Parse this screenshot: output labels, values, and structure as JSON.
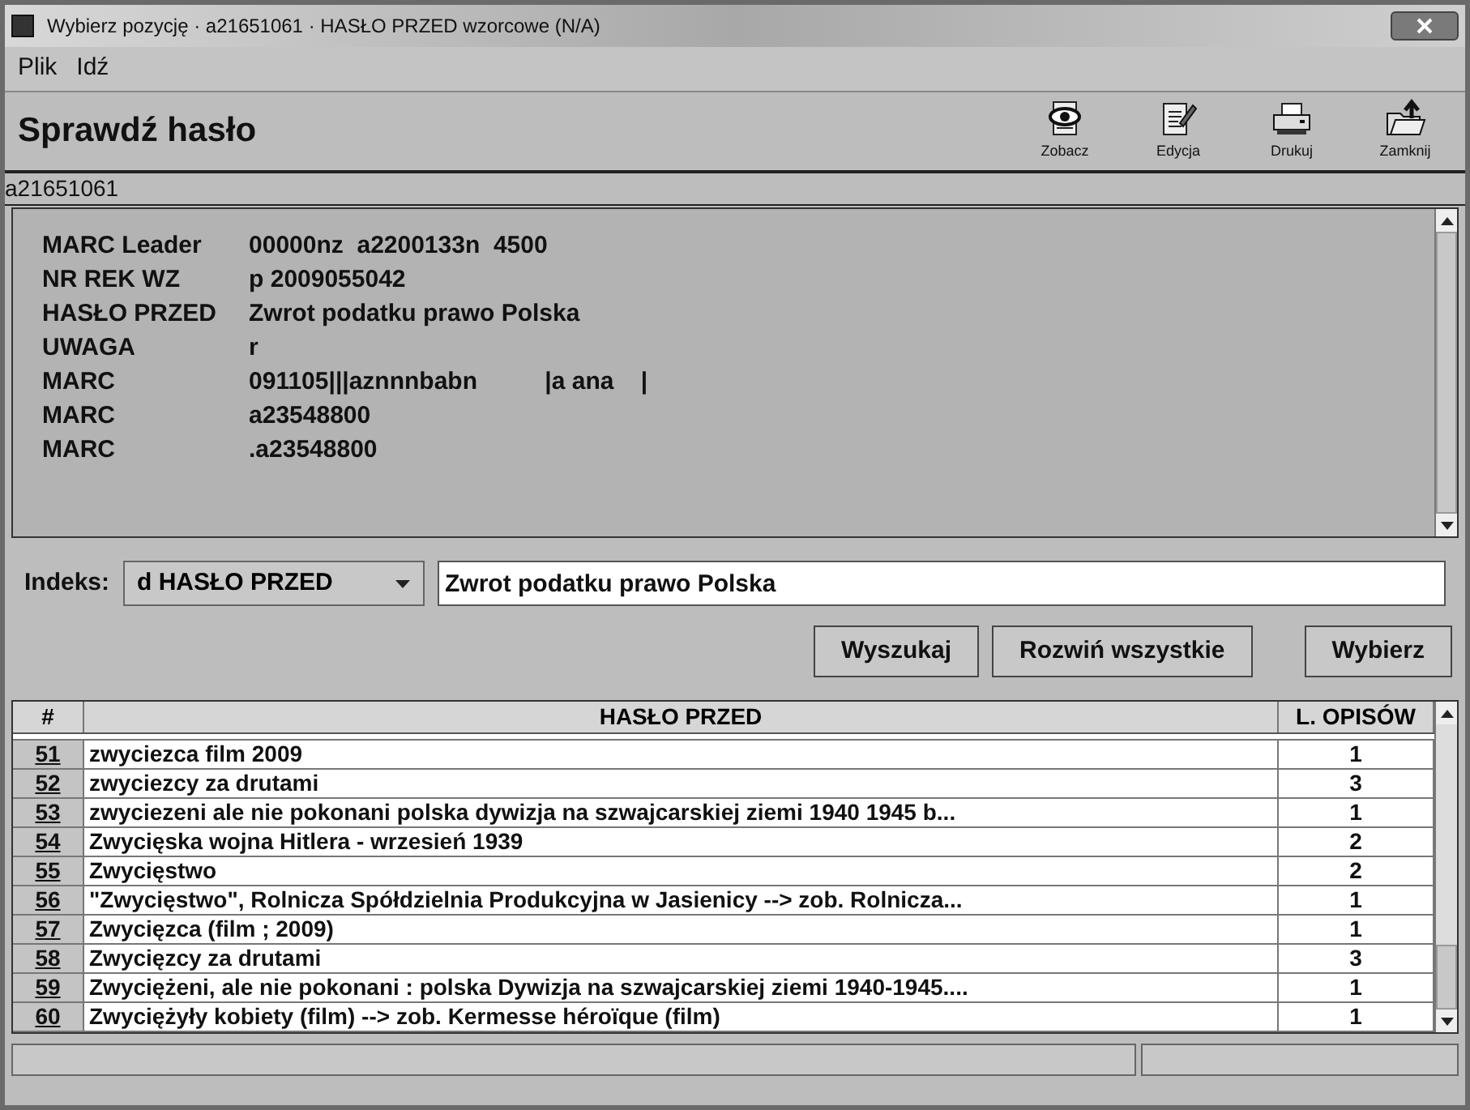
{
  "window": {
    "title": "Wybierz pozycję · a21651061 · HASŁO PRZED wzorcowe (N/A)"
  },
  "menu": [
    "Plik",
    "Idź"
  ],
  "header": {
    "title": "Sprawdź hasło",
    "tools": [
      {
        "label": "Zobacz",
        "kind": "view"
      },
      {
        "label": "Edycja",
        "kind": "edit"
      },
      {
        "label": "Drukuj",
        "kind": "print"
      },
      {
        "label": "Zamknij",
        "kind": "close"
      }
    ]
  },
  "record_id": "a21651061",
  "fields": [
    {
      "name": "MARC Leader",
      "value": "00000nz  a2200133n  4500"
    },
    {
      "name": "NR REK WZ",
      "value": "p 2009055042"
    },
    {
      "name": "HASŁO PRZED",
      "value": "Zwrot podatku prawo Polska"
    },
    {
      "name": "UWAGA",
      "value": "r"
    },
    {
      "name": "MARC",
      "value": "091105|||aznnnbabn          |a ana    |"
    },
    {
      "name": "MARC",
      "value": "a23548800"
    },
    {
      "name": "MARC",
      "value": ".a23548800"
    }
  ],
  "index": {
    "label": "Indeks:",
    "selected_index": "d HASŁO PRZED",
    "query": "Zwrot podatku prawo Polska"
  },
  "buttons": [
    "Wyszukaj",
    "Rozwiń wszystkie",
    "Wybierz"
  ],
  "table": {
    "columns": [
      "#",
      "HASŁO PRZED",
      "L. OPISÓW"
    ],
    "rows": [
      {
        "num": "51",
        "heading": "zwyciezca film 2009",
        "count": "1"
      },
      {
        "num": "52",
        "heading": "zwyciezcy za drutami",
        "count": "3"
      },
      {
        "num": "53",
        "heading": "zwyciezeni ale nie pokonani polska dywizja na szwajcarskiej ziemi 1940 1945 b...",
        "count": "1"
      },
      {
        "num": "54",
        "heading": "Zwycięska wojna Hitlera - wrzesień 1939",
        "count": "2"
      },
      {
        "num": "55",
        "heading": "Zwycięstwo",
        "count": "2"
      },
      {
        "num": "56",
        "heading": "\"Zwycięstwo\", Rolnicza Spółdzielnia Produkcyjna w Jasienicy --> zob. Rolnicza...",
        "count": "1"
      },
      {
        "num": "57",
        "heading": "Zwycięzca (film ; 2009)",
        "count": "1"
      },
      {
        "num": "58",
        "heading": "Zwycięzcy za drutami",
        "count": "3"
      },
      {
        "num": "59",
        "heading": "Zwyciężeni, ale nie pokonani : polska Dywizja na szwajcarskiej ziemi 1940-1945....",
        "count": "1"
      },
      {
        "num": "60",
        "heading": "Zwyciężyły kobiety (film) --> zob. Kermesse héroïque (film)",
        "count": "1"
      }
    ]
  }
}
